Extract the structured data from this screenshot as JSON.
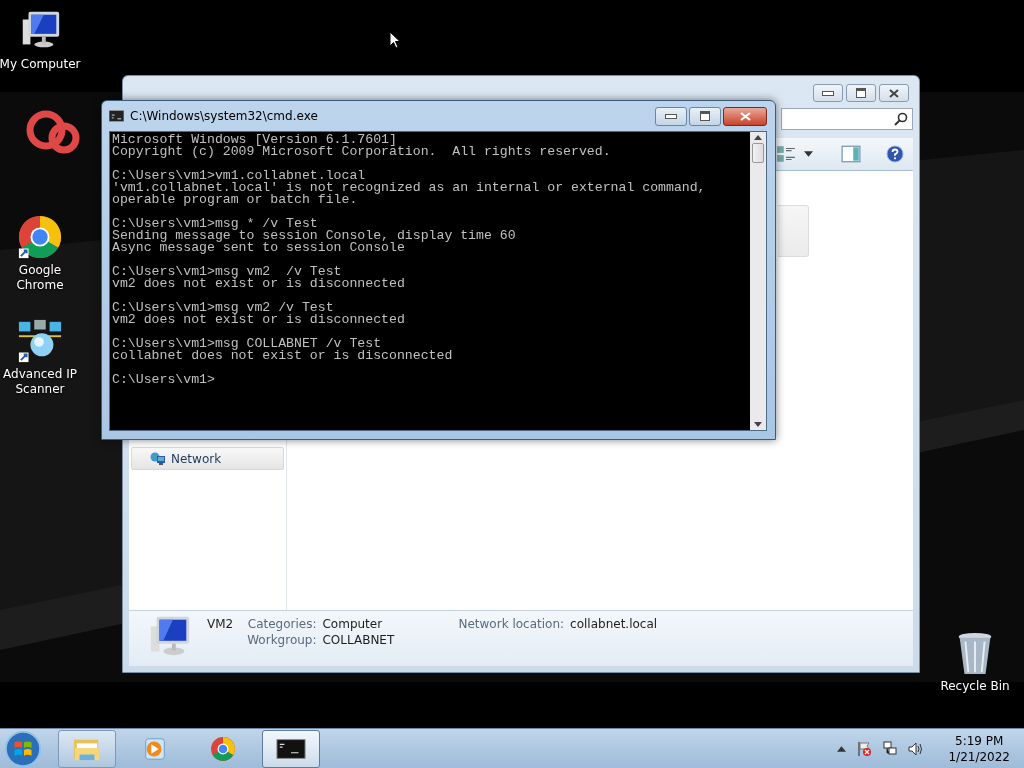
{
  "desktop_icons": [
    {
      "label": "My Computer",
      "kind": "computer"
    },
    {
      "label": "Google Chrome",
      "kind": "chrome"
    },
    {
      "label": "Advanced IP Scanner",
      "kind": "scanner"
    },
    {
      "label": "Recycle Bin",
      "kind": "bin"
    }
  ],
  "explorer": {
    "nav_items": [
      {
        "label": "Network",
        "selected": true
      }
    ],
    "details": {
      "name": "VM2",
      "fields": [
        {
          "label": "Categories:",
          "value": "Computer"
        },
        {
          "label": "Workgroup:",
          "value": "COLLABNET"
        },
        {
          "label": "Network location:",
          "value": "collabnet.local"
        }
      ]
    }
  },
  "cmd": {
    "title": "C:\\Windows\\system32\\cmd.exe",
    "blocks": [
      [
        "Microsoft Windows [Version 6.1.7601]",
        "Copyright (c) 2009 Microsoft Corporation.  All rights reserved."
      ],
      [
        "C:\\Users\\vm1>vm1.collabnet.local",
        "'vm1.collabnet.local' is not recognized as an internal or external command,",
        "operable program or batch file."
      ],
      [
        "C:\\Users\\vm1>msg * /v Test",
        "Sending message to session Console, display time 60",
        "Async message sent to session Console"
      ],
      [
        "C:\\Users\\vm1>msg vm2  /v Test",
        "vm2 does not exist or is disconnected"
      ],
      [
        "C:\\Users\\vm1>msg vm2 /v Test",
        "vm2 does not exist or is disconnected"
      ],
      [
        "C:\\Users\\vm1>msg COLLABNET /v Test",
        "collabnet does not exist or is disconnected"
      ],
      [
        "C:\\Users\\vm1>"
      ]
    ]
  },
  "taskbar": {
    "buttons": [
      {
        "kind": "explorer",
        "running": true,
        "selected": false
      },
      {
        "kind": "media",
        "running": false,
        "selected": false
      },
      {
        "kind": "chrome",
        "running": false,
        "selected": false
      },
      {
        "kind": "cmd",
        "running": true,
        "selected": true
      }
    ],
    "clock": {
      "time": "5:19 PM",
      "date": "1/21/2022"
    }
  }
}
